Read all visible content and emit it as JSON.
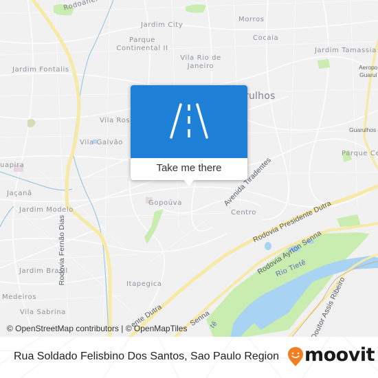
{
  "map": {
    "colors": {
      "background": "#f1f1f2",
      "highway": "#f7e9a6",
      "park": "#c9ecb0",
      "water": "#a9d3f2",
      "river": "#8ebfe0",
      "accent": "#1f80d8",
      "brand_orange": "#f47d1f"
    },
    "place_labels": [
      "Rodoanel Mário Covas",
      "Jardim City",
      "Parque Continental II",
      "Morros",
      "Cocaia",
      "Jardim Tamassia",
      "Aeroporto Guarulhos",
      "Vila Rio de Janeiro",
      "Jardim Fontalis",
      "Guarulhos",
      "Vila Rosália",
      "Vila Galvão",
      "Guarulhos",
      "Parque Cecap",
      "Tremembé / Cachoeira Guapira",
      "Jaçanã",
      "Jardim Modelo",
      "Gopoúva",
      "Centro",
      "Jardim Brasil",
      "Itapegica",
      "Medeiros",
      "Vila Sabrina"
    ],
    "labels": {
      "rodoanel": "Rodoanel Má",
      "jardim_city": "Jardim City",
      "parque_continental_1": "Parque",
      "parque_continental_2": "Continental II",
      "morros": "Morros",
      "cocaia": "Cocaia",
      "jardim_tamassia": "Jardim Tamassia",
      "aeroporto_1": "Aeropo",
      "aeroporto_2": "Guarul",
      "vila_rio_1": "Vila Rio de",
      "vila_rio_2": "Janeiro",
      "jardim_fontalis": "Jardim Fontalis",
      "guarulhos_city": "rulhos",
      "vila_rosa": "Vila Rosa",
      "vila_galvao": "Vila Galvão",
      "guarulhos_small": "Guarulhos",
      "parque_ce": "Parque Ce",
      "guapira": "uapira",
      "jacana": "Jaçanã",
      "jardim_modelo": "Jardim Modelo",
      "gopouva": "Gopoúva",
      "centro": "Centro",
      "jardim_brasil": "Jardim Brasil",
      "itapegica": "Itapegica",
      "medeiros": "Medeiros",
      "vila_sabrina": "Vila Sabrina"
    },
    "roads": {
      "fernao_dias": "Rodovia Fernão Dias",
      "tiradentes": "Avenida Tiradentes",
      "dutra": "Rodovia Presidente Dutra",
      "dutra_lower": "ente Dutra",
      "ayrton_senna": "Rodovia Ayrton Senna",
      "senna_lower": "Senna",
      "assis_ribeiro": "Doutor Assis Ribeiro"
    },
    "water": {
      "rio_tiete": "Rio Tietê",
      "tiete_lower": "tê"
    }
  },
  "popup": {
    "icon": "road-icon",
    "action_label": "Take me there"
  },
  "attribution": "© OpenStreetMap contributors | © OpenMapTiles",
  "footer": {
    "title": "Rua Soldado Felisbino Dos Santos, Sao Paulo Region",
    "brand": "moovit",
    "brand_icon": "moovit-pin-smile-icon"
  }
}
